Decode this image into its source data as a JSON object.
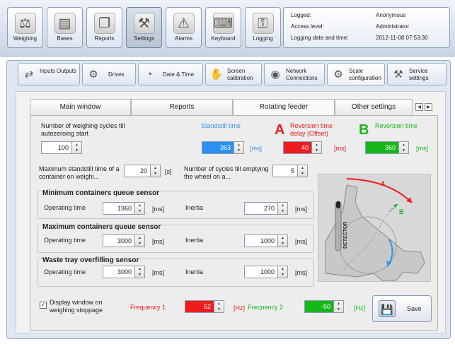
{
  "toolbar": {
    "buttons": [
      {
        "label": "Weighing",
        "icon": "scale-icon",
        "glyph": "⚖"
      },
      {
        "label": "Bases",
        "icon": "database-icon",
        "glyph": "▤"
      },
      {
        "label": "Reports",
        "icon": "report-icon",
        "glyph": "❐"
      },
      {
        "label": "Settings",
        "icon": "tools-icon",
        "glyph": "⚒"
      },
      {
        "label": "Alarms",
        "icon": "warning-icon",
        "glyph": "⚠"
      },
      {
        "label": "Keyboard",
        "icon": "keyboard-icon",
        "glyph": "⌨"
      },
      {
        "label": "Logging",
        "icon": "key-icon",
        "glyph": "⚿"
      }
    ]
  },
  "login": {
    "logged_label": "Logged:",
    "logged_value": "Anonymous",
    "access_label": "Access level:",
    "access_value": "Administrator",
    "date_label": "Logging date and time:",
    "date_value": "2012-11-08 07:53:30"
  },
  "categories": [
    {
      "label": "Inputs Outputs",
      "icon": "io-icon",
      "glyph": "⇄"
    },
    {
      "label": "Drives",
      "icon": "drive-icon",
      "glyph": "⚙"
    },
    {
      "label": "Date & Time",
      "icon": "clock-icon",
      "glyph": "◔"
    },
    {
      "label": "Screen calibration",
      "icon": "calibration-icon",
      "glyph": "✋"
    },
    {
      "label": "Network Connections",
      "icon": "network-icon",
      "glyph": "◉"
    },
    {
      "label": "Scale configuration",
      "icon": "config-icon",
      "glyph": "⚙"
    },
    {
      "label": "Service settings",
      "icon": "service-icon",
      "glyph": "⚒"
    }
  ],
  "tabs": [
    "Main window",
    "Reports",
    "Rotating feeder",
    "Other settings"
  ],
  "tab_arrows": {
    "left": "◀",
    "right": "▶"
  },
  "spin_arrows": {
    "up": "▲",
    "down": "▼"
  },
  "feeder": {
    "autozero_label": "Number of weighing cycles till autozeroing start",
    "autozero_value": "100",
    "standstill_label": "Standstill time",
    "standstill_value": "363",
    "standstill_unit": "[ms]",
    "reversion_delay_letter": "A",
    "reversion_delay_label": "Reversion time delay (Offset)",
    "reversion_delay_value": "40",
    "reversion_delay_unit": "[ms]",
    "reversion_letter": "B",
    "reversion_label": "Reversion time",
    "reversion_value": "360",
    "reversion_unit": "[ms]",
    "max_standstill_label": "Maximum standstill time of a container on weighi...",
    "max_standstill_value": "20",
    "max_standstill_unit": "[s]",
    "cycles_empty_label": "Number of cycles till emptying the wheel on a...",
    "cycles_empty_value": "5"
  },
  "groups": [
    {
      "title": "Minimum containers queue sensor",
      "op_label": "Operating time",
      "op_value": "1960",
      "op_unit": "[ms]",
      "inertia_label": "Inertia",
      "inertia_value": "270",
      "inertia_unit": "[ms]"
    },
    {
      "title": "Maximum containers queue sensor",
      "op_label": "Operating time",
      "op_value": "3000",
      "op_unit": "[ms]",
      "inertia_label": "Inertia",
      "inertia_value": "1000",
      "inertia_unit": "[ms]"
    },
    {
      "title": "Waste tray overfilling sensor",
      "op_label": "Operating time",
      "op_value": "3000",
      "op_unit": "[ms]",
      "inertia_label": "Inertia",
      "inertia_value": "1000",
      "inertia_unit": "[ms]"
    }
  ],
  "diagram": {
    "detector_label": "DETECTOR",
    "label_a": "A",
    "label_b": "B"
  },
  "bottom": {
    "display_label": "Display window on weighing stoppage",
    "display_checked": "✓",
    "freq1_label": "Frequency 1",
    "freq1_value": "52",
    "freq1_unit": "[Hz]",
    "freq2_label": "Frequency 2",
    "freq2_value": "-50",
    "freq2_unit": "[Hz]"
  },
  "save": {
    "label": "Save",
    "icon": "floppy-icon",
    "glyph": "💾"
  },
  "colors": {
    "blue_text": "#3a8ee6",
    "red": "#ee1c1c",
    "green": "#16b818"
  }
}
